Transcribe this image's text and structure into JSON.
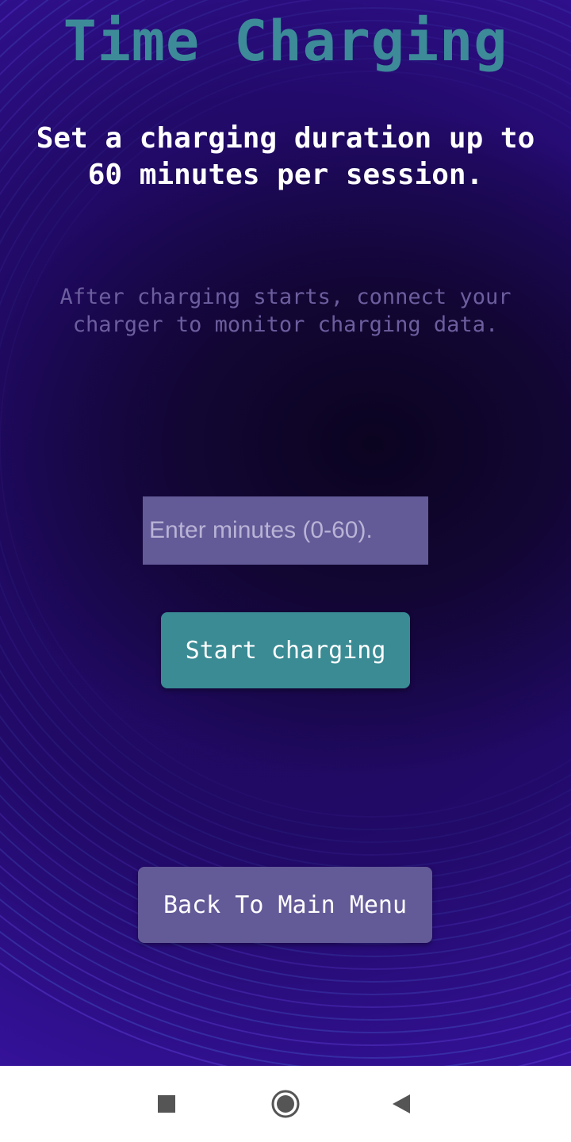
{
  "screen": {
    "title": "Time Charging",
    "subtitle": "Set a charging duration up to 60 minutes per session.",
    "note": "After charging starts, connect your charger to monitor charging data."
  },
  "minutes_input": {
    "value": "",
    "placeholder": "Enter minutes (0-60)."
  },
  "buttons": {
    "start_label": "Start charging",
    "back_label": "Back To Main Menu"
  },
  "navbar": {
    "icons": [
      "recents-icon",
      "home-icon",
      "back-icon"
    ]
  },
  "colors": {
    "title": "#3d8a99",
    "start_button": "#3a8b94",
    "secondary": "#635a98",
    "note_text": "#6c5e9e",
    "background": "#1b0a55"
  }
}
